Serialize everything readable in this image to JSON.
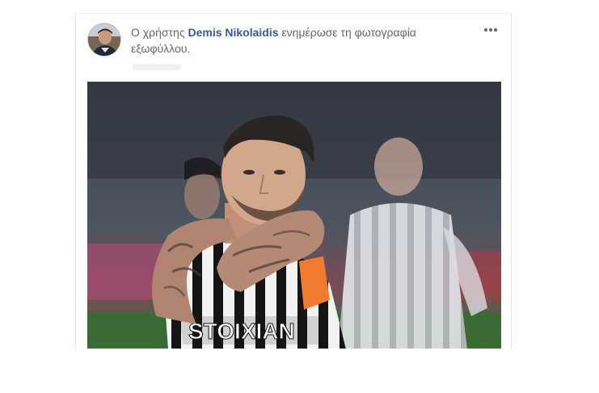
{
  "post": {
    "author_prefix": "Ο χρήστης",
    "author_name": "Demis Nikolaidis",
    "action_text": "ενημέρωσε τη φωτογραφία εξωφύλλου.",
    "sponsor_text": "STOIXIAN"
  },
  "colors": {
    "link": "#385898",
    "secondary_text": "#616770",
    "armband": "#f07a2e"
  },
  "icons": {
    "more": "more-horizontal-icon"
  }
}
